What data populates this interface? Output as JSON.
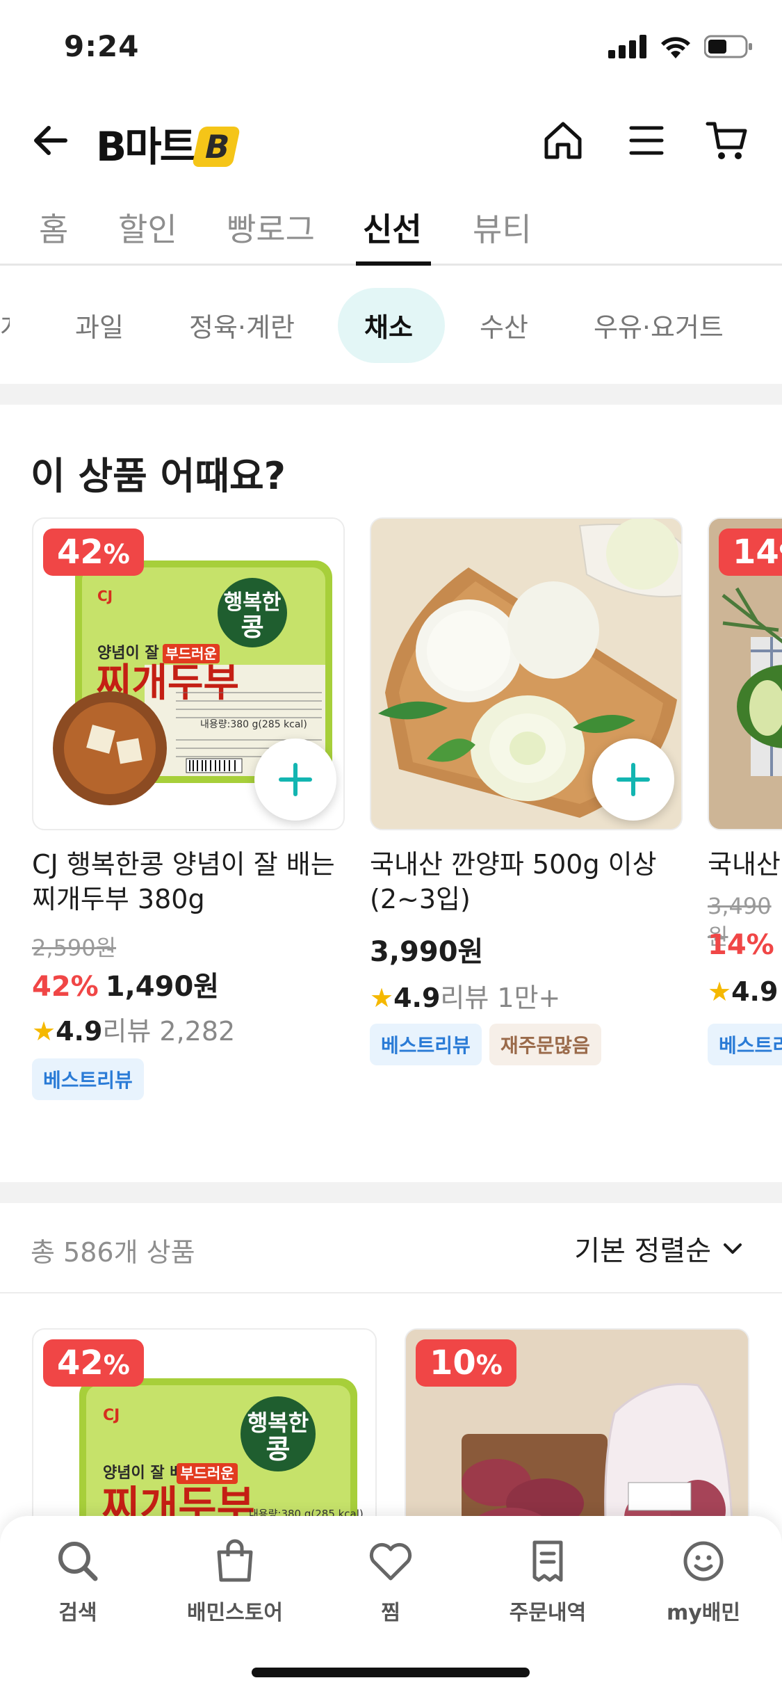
{
  "status_bar": {
    "time": "9:24"
  },
  "header": {
    "brand": "B마트"
  },
  "main_tabs": [
    {
      "label": "홈"
    },
    {
      "label": "할인"
    },
    {
      "label": "빵로그"
    },
    {
      "label": "신선",
      "active": true
    },
    {
      "label": "뷰티"
    }
  ],
  "sub_categories": [
    {
      "label": "과일"
    },
    {
      "label": "정육·계란"
    },
    {
      "label": "채소",
      "active": true
    },
    {
      "label": "수산"
    },
    {
      "label": "우유·요거트"
    }
  ],
  "section": {
    "title": "이 상품 어때요?"
  },
  "recommended": [
    {
      "discount_badge": "42",
      "name": "CJ 행복한콩 양념이 잘 배는찌개두부 380g",
      "original_price": "2,590원",
      "discount": "42%",
      "price": "1,490원",
      "rating": "4.9",
      "review_label": "리뷰",
      "review_count": "2,282",
      "tags": [
        "베스트리뷰"
      ]
    },
    {
      "name": "국내산 깐양파 500g 이상 (2~3입)",
      "price": "3,990원",
      "rating": "4.9",
      "review_label": "리뷰",
      "review_count": "1만+",
      "tags": [
        "베스트리뷰",
        "재주문많음"
      ]
    },
    {
      "discount_badge": "14",
      "name": "국내산",
      "original_price": "3,490원",
      "discount": "14%",
      "rating": "4.9",
      "tags": [
        "베스트리"
      ]
    }
  ],
  "product_list": {
    "total_count": "총 586개 상품",
    "sort_label": "기본 정렬순",
    "items": [
      {
        "discount_badge": "42"
      },
      {
        "discount_badge": "10"
      }
    ]
  },
  "packaging_text": {
    "tofu_line1": "양념이 잘 배는",
    "tofu_tag": "부드러운",
    "tofu_title": "찌개두부",
    "tofu_brand": "행복한",
    "tofu_brand2": "콩",
    "tofu_maker": "CJ",
    "tofu_weight": "내용량:380 g(285 kcal)"
  },
  "bottom_nav": [
    {
      "label": "검색"
    },
    {
      "label": "배민스토어"
    },
    {
      "label": "찜"
    },
    {
      "label": "주문내역"
    },
    {
      "label": "my배민"
    }
  ],
  "colors": {
    "accent": "#13b5b1",
    "discount": "#f04646",
    "star": "#f5b800",
    "pill": "#e3f6f6"
  }
}
